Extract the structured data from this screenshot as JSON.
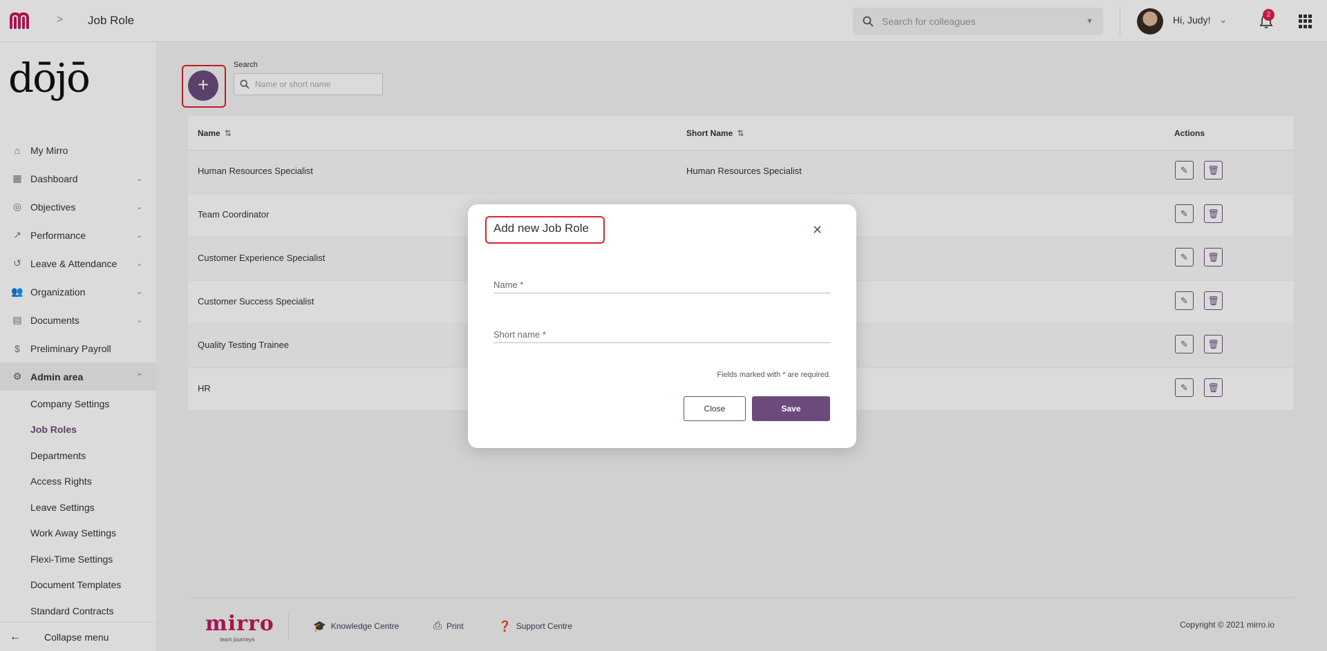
{
  "header": {
    "breadcrumb_sep": ">",
    "page_title": "Job Role",
    "search_placeholder": "Search for colleagues",
    "greeting": "Hi, Judy!",
    "notification_count": "2"
  },
  "sidebar": {
    "brand": "dōjō",
    "items": [
      {
        "label": "My Mirro",
        "icon": "home-icon"
      },
      {
        "label": "Dashboard",
        "icon": "dashboard-icon"
      },
      {
        "label": "Objectives",
        "icon": "target-icon"
      },
      {
        "label": "Performance",
        "icon": "trend-icon"
      },
      {
        "label": "Leave & Attendance",
        "icon": "history-icon"
      },
      {
        "label": "Organization",
        "icon": "people-icon"
      },
      {
        "label": "Documents",
        "icon": "document-icon"
      },
      {
        "label": "Preliminary Payroll",
        "icon": "dollar-icon"
      },
      {
        "label": "Admin area",
        "icon": "gear-icon"
      }
    ],
    "admin_sub": [
      "Company Settings",
      "Job Roles",
      "Departments",
      "Access Rights",
      "Leave Settings",
      "Work Away Settings",
      "Flexi-Time Settings",
      "Document Templates",
      "Standard Contracts"
    ],
    "collapse_label": "Collapse menu"
  },
  "toolbar": {
    "add_label": "+",
    "search_label": "Search",
    "search_placeholder": "Name or short name"
  },
  "table": {
    "headers": {
      "name": "Name",
      "short_name": "Short Name",
      "actions": "Actions"
    },
    "sort_glyph": "⇅",
    "rows": [
      {
        "name": "Human Resources Specialist",
        "short_name": "Human Resources Specialist"
      },
      {
        "name": "Team Coordinator",
        "short_name": ""
      },
      {
        "name": "Customer Experience Specialist",
        "short_name": ""
      },
      {
        "name": "Customer Success Specialist",
        "short_name": ""
      },
      {
        "name": "Quality Testing Trainee",
        "short_name": ""
      },
      {
        "name": "HR",
        "short_name": ""
      }
    ]
  },
  "footer": {
    "brand": "mirro",
    "tagline": "team journeys",
    "links": [
      "Knowledge Centre",
      "Print",
      "Support Centre"
    ],
    "copyright": "Copyright © 2021 mirro.io"
  },
  "modal": {
    "title": "Add new Job Role",
    "close_glyph": "✕",
    "name_label": "Name *",
    "short_name_label": "Short name *",
    "required_note": "Fields marked with * are required.",
    "close_button": "Close",
    "save_button": "Save"
  },
  "colors": {
    "accent": "#6b4b7d",
    "brand": "#c2185b",
    "highlight": "#e0202a"
  }
}
